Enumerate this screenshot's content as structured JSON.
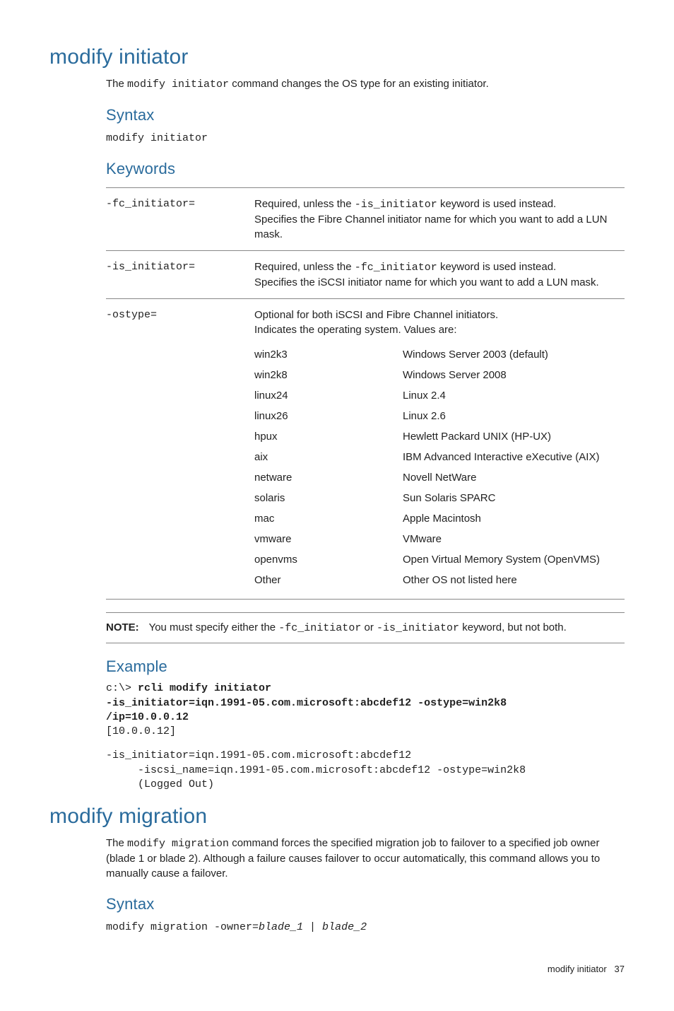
{
  "section1": {
    "title": "modify initiator",
    "intro_pre": "The ",
    "intro_code": "modify initiator",
    "intro_post": " command changes the OS type for an existing initiator.",
    "syntax_heading": "Syntax",
    "syntax_text": "modify initiator",
    "keywords_heading": "Keywords",
    "keywords": [
      {
        "name": "-fc_initiator=",
        "line1_pre": "Required, unless the ",
        "line1_code": "-is_initiator",
        "line1_post": " keyword is used instead.",
        "line2": "Specifies the Fibre Channel initiator name for which you want to add a LUN mask."
      },
      {
        "name": "-is_initiator=",
        "line1_pre": "Required, unless the ",
        "line1_code": "-fc_initiator",
        "line1_post": " keyword is used instead.",
        "line2": "Specifies the iSCSI initiator name for which you want to add a LUN mask."
      },
      {
        "name": "-ostype=",
        "line1": "Optional for both iSCSI and Fibre Channel initiators.",
        "line2": "Indicates the operating system. Values are:",
        "values": [
          {
            "v": "win2k3",
            "d": "Windows Server 2003 (default)"
          },
          {
            "v": "win2k8",
            "d": "Windows Server 2008"
          },
          {
            "v": "linux24",
            "d": "Linux 2.4"
          },
          {
            "v": "linux26",
            "d": "Linux 2.6"
          },
          {
            "v": "hpux",
            "d": "Hewlett Packard UNIX (HP-UX)"
          },
          {
            "v": "aix",
            "d": "IBM Advanced Interactive eXecutive (AIX)"
          },
          {
            "v": "netware",
            "d": "Novell NetWare"
          },
          {
            "v": "solaris",
            "d": "Sun Solaris SPARC"
          },
          {
            "v": "mac",
            "d": "Apple Macintosh"
          },
          {
            "v": "vmware",
            "d": "VMware"
          },
          {
            "v": "openvms",
            "d": "Open Virtual Memory System (OpenVMS)"
          },
          {
            "v": "Other",
            "d": "Other OS not listed here"
          }
        ]
      }
    ],
    "note_label": "NOTE:",
    "note_pre": "You must specify either the ",
    "note_code1": "-fc_initiator",
    "note_mid": " or ",
    "note_code2": "-is_initiator",
    "note_post": " keyword, but not both.",
    "example_heading": "Example",
    "example": {
      "prompt": "c:\\> ",
      "bold1": "rcli modify initiator",
      "bold2": "-is_initiator=iqn.1991-05.com.microsoft:abcdef12 -ostype=win2k8",
      "bold3": "/ip=10.0.0.12",
      "out1": "[10.0.0.12]",
      "out2": "-is_initiator=iqn.1991-05.com.microsoft:abcdef12",
      "out3": "     -iscsi_name=iqn.1991-05.com.microsoft:abcdef12 -ostype=win2k8",
      "out4": "     (Logged Out)"
    }
  },
  "section2": {
    "title": "modify migration",
    "intro_pre": "The ",
    "intro_code": "modify migration",
    "intro_post": " command forces the specified migration job to failover to a specified job owner (blade 1 or blade 2). Although a failure causes failover to occur automatically, this command allows you to manually cause a failover.",
    "syntax_heading": "Syntax",
    "syntax_plain": "modify migration -owner=",
    "syntax_italic": "blade_1 | blade_2"
  },
  "footer": {
    "label": "modify initiator",
    "page": "37"
  }
}
